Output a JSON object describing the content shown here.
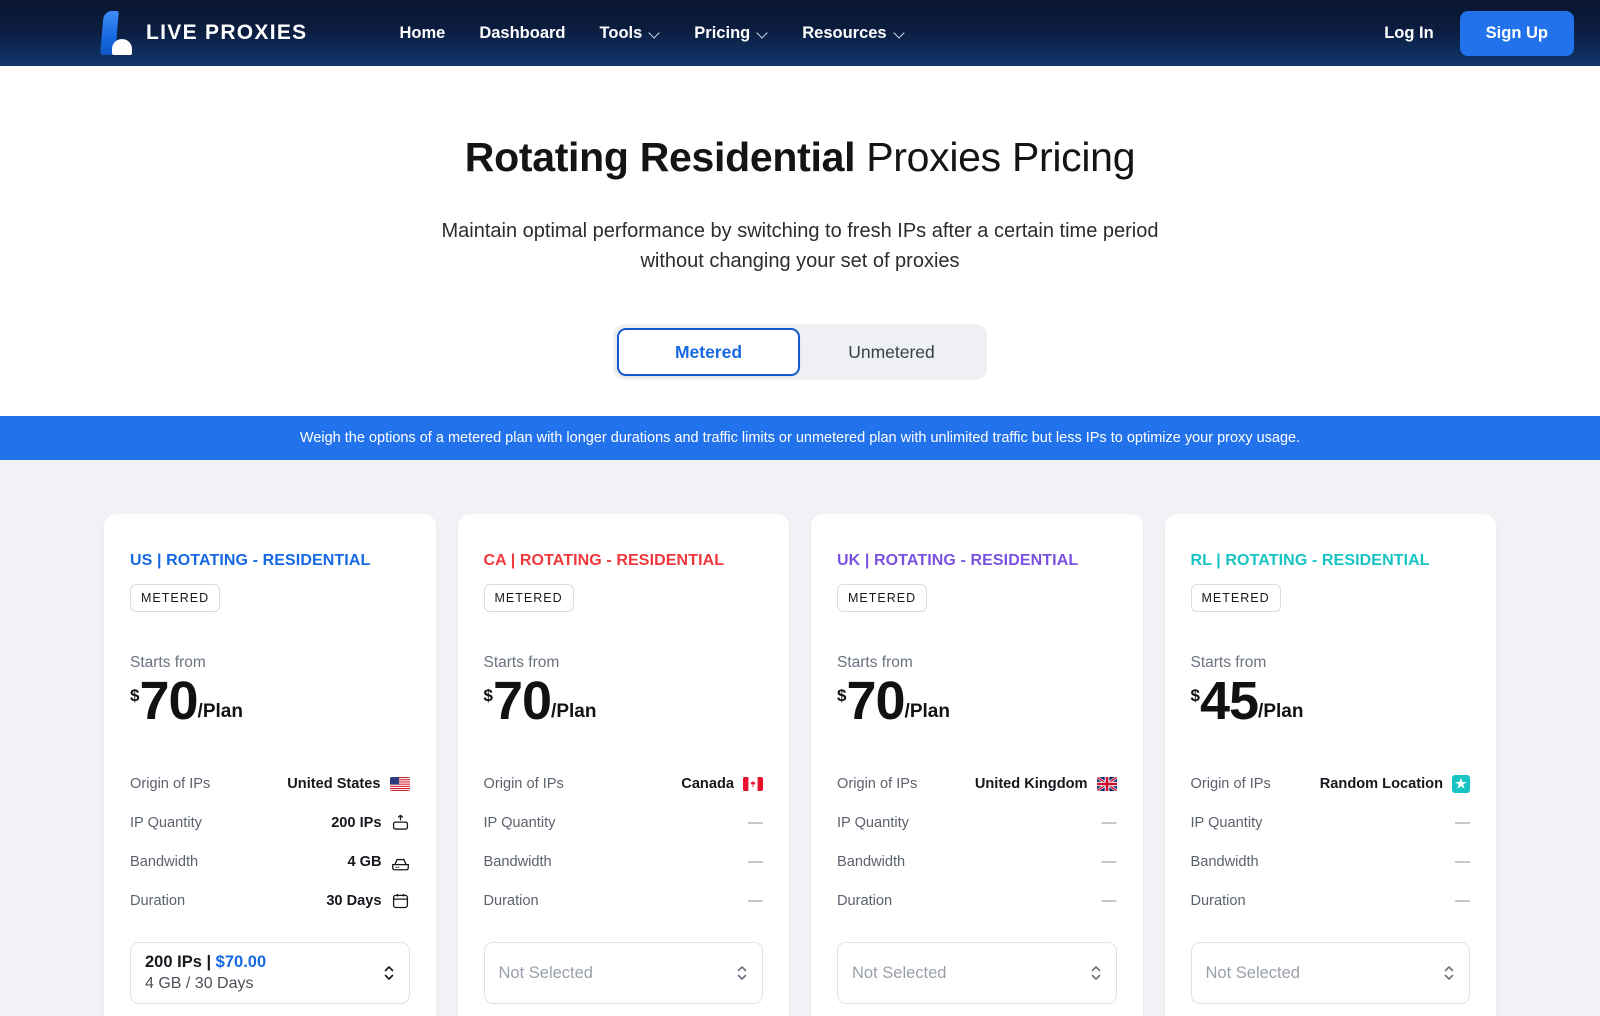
{
  "nav": {
    "brand": "LIVE PROXIES",
    "logo_icon": "live-proxies-logo",
    "links": [
      {
        "label": "Home",
        "has_caret": false
      },
      {
        "label": "Dashboard",
        "has_caret": false
      },
      {
        "label": "Tools",
        "has_caret": true
      },
      {
        "label": "Pricing",
        "has_caret": true
      },
      {
        "label": "Resources",
        "has_caret": true
      }
    ],
    "login": "Log In",
    "signup": "Sign Up",
    "signup_color": "#2272eb"
  },
  "hero": {
    "title_bold": "Rotating Residential",
    "title_rest": " Proxies Pricing",
    "subtitle": "Maintain optimal performance by switching to fresh IPs after a certain time period without changing your set of proxies"
  },
  "toggle": {
    "options": [
      "Metered",
      "Unmetered"
    ],
    "selected": "Metered",
    "active_color": "#1668e3"
  },
  "banner": {
    "text": "Weigh the options of a metered plan with longer durations and traffic limits or unmetered plan with unlimited traffic but less IPs to optimize your proxy usage.",
    "background": "#2272eb"
  },
  "spec_labels": {
    "origin": "Origin of IPs",
    "ip_quantity": "IP Quantity",
    "bandwidth": "Bandwidth",
    "duration": "Duration",
    "starts_from": "Starts from",
    "currency": "$",
    "per": "/Plan",
    "empty": "—"
  },
  "cards": [
    {
      "title": "US | ROTATING - RESIDENTIAL",
      "title_color": "#1668e3",
      "badge": "METERED",
      "price": "70",
      "origin": "United States",
      "origin_icon": "flag-us",
      "ip_quantity": "200 IPs",
      "ip_quantity_icon": "server-upload-icon",
      "bandwidth": "4 GB",
      "bandwidth_icon": "hard-drive-icon",
      "duration": "30 Days",
      "duration_icon": "calendar-icon",
      "selector": {
        "selected": true,
        "line1_qty": "200 IPs | ",
        "line1_price": "$70.00",
        "line2": "4 GB / 30 Days",
        "placeholder": "Not Selected"
      }
    },
    {
      "title": "CA | ROTATING - RESIDENTIAL",
      "title_color": "#f0383c",
      "badge": "METERED",
      "price": "70",
      "origin": "Canada",
      "origin_icon": "flag-ca",
      "ip_quantity": "—",
      "bandwidth": "—",
      "duration": "—",
      "selector": {
        "selected": false,
        "placeholder": "Not Selected"
      }
    },
    {
      "title": "UK | ROTATING - RESIDENTIAL",
      "title_color": "#7b52e0",
      "badge": "METERED",
      "price": "70",
      "origin": "United Kingdom",
      "origin_icon": "flag-uk",
      "ip_quantity": "—",
      "bandwidth": "—",
      "duration": "—",
      "selector": {
        "selected": false,
        "placeholder": "Not Selected"
      }
    },
    {
      "title": "RL | ROTATING - RESIDENTIAL",
      "title_color": "#17c3c3",
      "badge": "METERED",
      "price": "45",
      "origin": "Random Location",
      "origin_icon": "globe-icon",
      "ip_quantity": "—",
      "bandwidth": "—",
      "duration": "—",
      "selector": {
        "selected": false,
        "placeholder": "Not Selected"
      }
    }
  ]
}
